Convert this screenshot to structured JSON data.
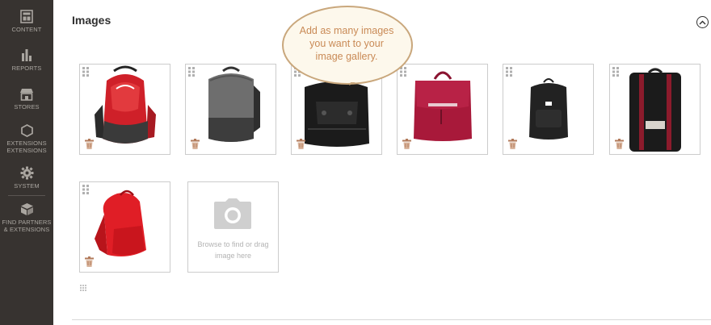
{
  "sidebar": {
    "items": [
      {
        "label": "CONTENT",
        "icon": "content-icon"
      },
      {
        "label": "REPORTS",
        "icon": "reports-icon"
      },
      {
        "label": "STORES",
        "icon": "stores-icon"
      },
      {
        "label": "EXTENSIONS EXTENSIONS",
        "icon": "extensions-icon"
      },
      {
        "label": "SYSTEM",
        "icon": "gear-icon"
      },
      {
        "label": "FIND PARTNERS & EXTENSIONS",
        "icon": "partners-icon"
      }
    ]
  },
  "images_section": {
    "title": "Images",
    "collapse_icon": "chevron-up-icon",
    "tooltip": "Add as many images you want to your image gallery.",
    "uploader_text": "Browse to find or drag image here",
    "uploader_icon": "camera-icon",
    "images": [
      {
        "name": "red-backpack",
        "color": "#d0222b"
      },
      {
        "name": "gray-backpack",
        "color": "#6b6b6b"
      },
      {
        "name": "black-backpack",
        "color": "#1d1d1d"
      },
      {
        "name": "burgundy-backpack",
        "color": "#a8193a"
      },
      {
        "name": "small-black-backpack",
        "color": "#222222"
      },
      {
        "name": "black-red-strap-backpack",
        "color": "#1b1b1b"
      },
      {
        "name": "red-daypack",
        "color": "#e01e26"
      }
    ]
  },
  "colors": {
    "sidebar_bg": "#373330",
    "sidebar_text": "#aaa6a0",
    "tooltip_text": "#c98a56",
    "trash": "#b27a5a"
  }
}
